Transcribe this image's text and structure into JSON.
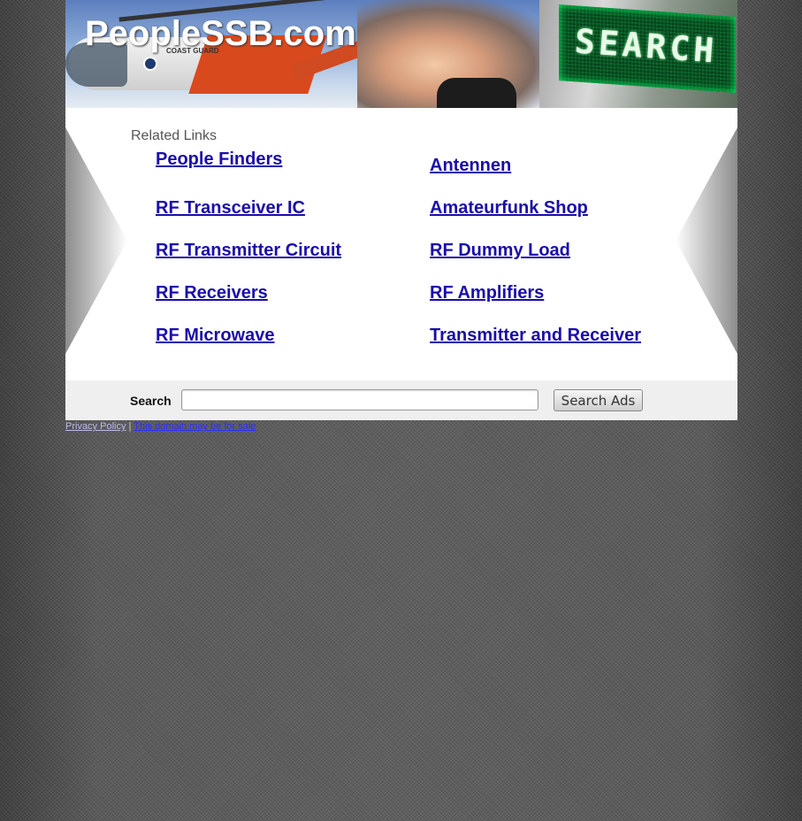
{
  "header": {
    "site_title": "PeopleSSB.com",
    "banner_sign": "SEARCH",
    "helicopter_marking": "COAST GUARD"
  },
  "related": {
    "heading": "Related Links",
    "links_left": [
      "People Finders",
      "RF Transceiver IC",
      "RF Transmitter Circuit",
      "RF Receivers",
      "RF Microwave"
    ],
    "links_right": [
      "Antennen",
      "Amateurfunk Shop",
      "RF Dummy Load",
      "RF Amplifiers",
      "Transmitter and Receiver"
    ]
  },
  "search": {
    "label": "Search",
    "input_value": "",
    "button_label": "Search Ads"
  },
  "footer": {
    "privacy_label": "Privacy Policy",
    "separator": "|",
    "sale_label": "This domain may be for sale"
  },
  "colors": {
    "link": "#1a0dab",
    "background": "#545454",
    "banner_screen": "#0c6a2d"
  }
}
